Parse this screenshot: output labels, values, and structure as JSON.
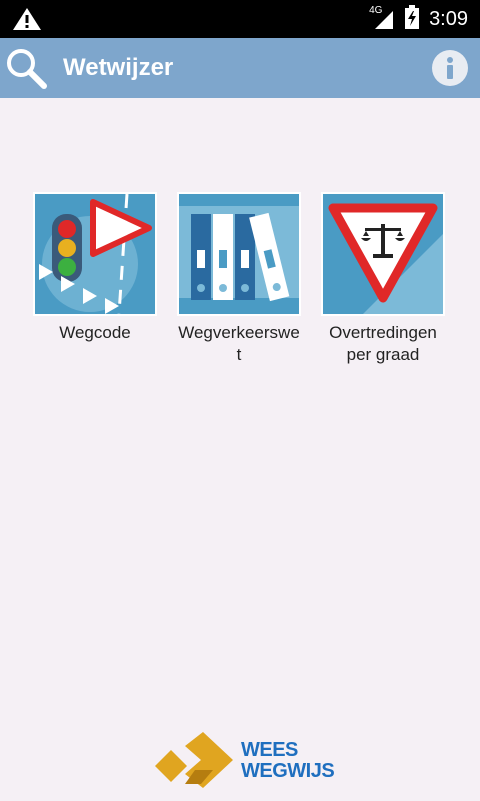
{
  "statusbar": {
    "network": "4G",
    "time": "3:09"
  },
  "appbar": {
    "title": "Wetwijzer"
  },
  "tiles": [
    {
      "label": "Wegcode"
    },
    {
      "label": "Wegverkeerswet"
    },
    {
      "label": "Overtredingen per graad"
    }
  ],
  "logo": {
    "line1": "WEES",
    "line2": "WEGWIJS"
  },
  "colors": {
    "appbar": "#7ea6cc",
    "statusbar": "#000000",
    "background": "#f5f0f5",
    "tile_blue": "#4a9bc4",
    "logo_blue": "#1f6fbf",
    "logo_gold": "#e0a520"
  }
}
